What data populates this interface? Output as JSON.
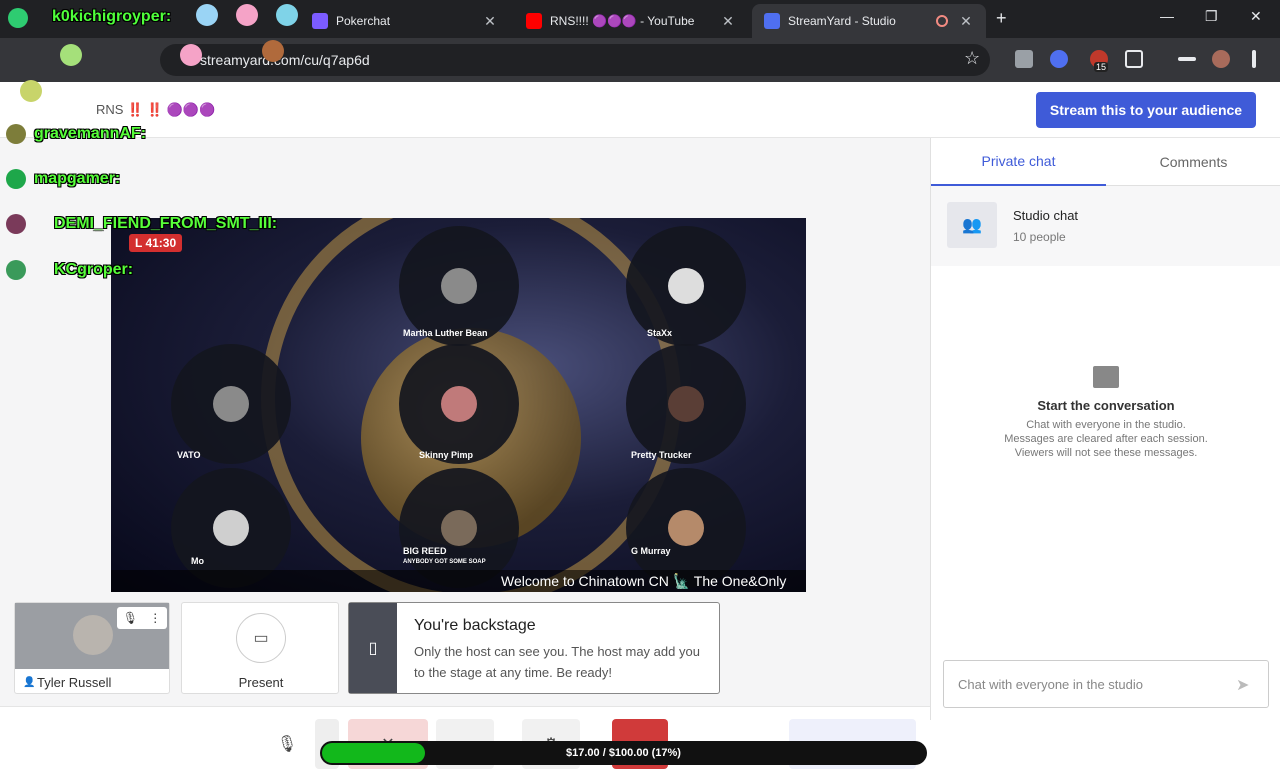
{
  "browser": {
    "tabs": [
      {
        "title": "Pokerchat",
        "icon": "pokerchat-favicon",
        "active": false
      },
      {
        "title": "RNS!!!! 🟣🟣🟣 - YouTube",
        "icon": "youtube-favicon",
        "active": false
      },
      {
        "title": "StreamYard - Studio",
        "icon": "streamyard-favicon",
        "active": true
      }
    ],
    "new_tab": "+",
    "minimize": "—",
    "maximize": "❐",
    "close": "✕",
    "url": "streamyard.com/cu/q7ap6d",
    "close_tab": "✕",
    "star": "☆",
    "extension_badge": "15"
  },
  "header": {
    "broadcast_name": "RNS ‼️ ‼️ 🟣🟣🟣",
    "stream_button": "Stream this to your audience"
  },
  "stage": {
    "live_timer": "L 41:30",
    "ticker": "Welcome to Chinatown CN 🗽 The One&Only",
    "participants": [
      {
        "name": "Martha Luther Bean"
      },
      {
        "name": "StaXx"
      },
      {
        "name": "VATO"
      },
      {
        "name": "Skinny Pimp"
      },
      {
        "name": "Pretty Trucker"
      },
      {
        "name": "Mo"
      },
      {
        "name": "BIG REED",
        "subtitle": "ANYBODY GOT SOME SOAP"
      },
      {
        "name": "G Murray"
      }
    ]
  },
  "self_tile": {
    "name": "Tyler Russell"
  },
  "present": {
    "label": "Present"
  },
  "backstage": {
    "title": "You're backstage",
    "message": "Only the host can see you. The host may add you to the stage at any time. Be ready!"
  },
  "goal": {
    "text": "$17.00 / $100.00 (17%)",
    "fraction": 0.17
  },
  "chat": {
    "tabs": {
      "private": "Private chat",
      "comments": "Comments"
    },
    "studio_title": "Studio chat",
    "studio_sub": "10 people",
    "empty_title": "Start the conversation",
    "empty_lines": [
      "Chat with everyone in the studio.",
      "Messages are cleared after each session.",
      "Viewers will not see these messages."
    ],
    "input_placeholder": "Chat with everyone in the studio"
  },
  "overlay": {
    "names": [
      "k0kichigroyper:",
      "gravemannAF:",
      "mapgamer:",
      "DEMI_FIEND_FROM_SMT_III:",
      "KCgroper:"
    ]
  },
  "colors": {
    "accent": "#3f5bd8",
    "overlay_text": "#57ff3a",
    "goal_fill": "#12b81b",
    "live": "#d32f2f"
  }
}
